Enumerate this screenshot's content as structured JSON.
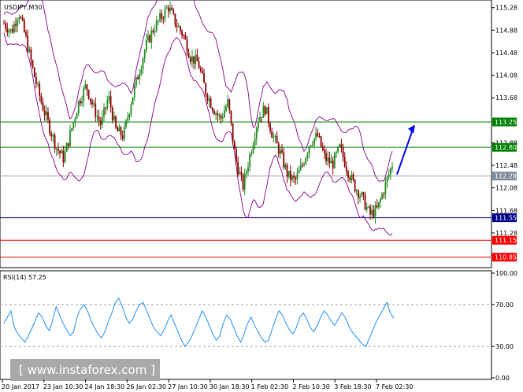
{
  "chart_data": {
    "type": "candlestick",
    "symbol_label": "USDJPY,M30",
    "price_axis": {
      "ticks": [
        "115.28",
        "114.88",
        "114.48",
        "114.08",
        "113.68",
        "112.88",
        "112.48",
        "112.08",
        "111.68",
        "111.28",
        "110.88"
      ],
      "ylim": [
        110.72,
        115.36
      ]
    },
    "time_axis": {
      "labels": [
        "20 Jan 2017",
        "23 Jan 10:30",
        "24 Jan 18:30",
        "26 Jan 02:30",
        "27 Jan 10:30",
        "30 Jan 18:30",
        "1 Feb 02:30",
        "2 Feb 10:30",
        "3 Feb 18:30",
        "7 Feb 02:30"
      ]
    },
    "levels": [
      {
        "value": "113.25",
        "color": "#008000",
        "label_bg": "#008000"
      },
      {
        "value": "112.80",
        "color": "#008000",
        "label_bg": "#008000"
      },
      {
        "value": "112.29",
        "color": "#a0a0a0",
        "label_bg": "#7f8c97"
      },
      {
        "value": "111.55",
        "color": "#00008b",
        "label_bg": "#00008b"
      },
      {
        "value": "111.15",
        "color": "#ff0000",
        "label_bg": "#ff0000"
      },
      {
        "value": "110.85",
        "color": "#ff0000",
        "label_bg": "#ff0000"
      }
    ],
    "projection_arrow": {
      "from": 112.29,
      "to": 113.2,
      "color": "#0000ff"
    },
    "price_path": [
      115.0,
      114.85,
      115.2,
      114.7,
      114.1,
      113.6,
      113.2,
      112.8,
      112.6,
      113.1,
      113.6,
      113.9,
      113.5,
      113.2,
      113.7,
      113.1,
      113.0,
      113.6,
      114.1,
      114.6,
      114.9,
      115.1,
      115.3,
      115.0,
      114.8,
      114.4,
      114.3,
      113.8,
      113.5,
      113.3,
      113.6,
      112.6,
      112.1,
      112.7,
      113.3,
      113.5,
      113.0,
      112.7,
      112.3,
      112.2,
      112.5,
      112.9,
      113.0,
      112.6,
      112.5,
      112.8,
      112.4,
      112.1,
      111.9,
      111.6,
      111.7,
      112.1,
      112.5
    ],
    "rsi": {
      "label": "RSI(14) 57.25",
      "ticks": [
        "100.00",
        "70.00",
        "30.00",
        "0.00"
      ],
      "ylim": [
        0,
        100
      ],
      "levels": [
        70,
        30
      ],
      "color": "#1e90ff",
      "values": [
        52,
        58,
        64,
        48,
        42,
        38,
        34,
        40,
        47,
        55,
        62,
        58,
        50,
        45,
        55,
        68,
        60,
        52,
        46,
        40,
        44,
        58,
        66,
        70,
        64,
        55,
        48,
        42,
        38,
        44,
        54,
        62,
        72,
        76,
        68,
        58,
        52,
        56,
        64,
        70,
        72,
        64,
        56,
        48,
        44,
        40,
        46,
        54,
        60,
        52,
        44,
        36,
        30,
        34,
        40,
        48,
        56,
        64,
        58,
        50,
        42,
        36,
        40,
        52,
        60,
        56,
        48,
        40,
        34,
        42,
        52,
        58,
        50,
        44,
        38,
        34,
        36,
        46,
        56,
        64,
        60,
        52,
        46,
        42,
        48,
        58,
        62,
        56,
        48,
        44,
        50,
        58,
        64,
        60,
        54,
        50,
        56,
        62,
        58,
        50,
        44,
        40,
        36,
        32,
        30,
        38,
        46,
        54,
        60,
        66,
        72,
        62,
        57
      ]
    }
  },
  "watermark": {
    "text": "[ www.instaforex.com ]"
  }
}
